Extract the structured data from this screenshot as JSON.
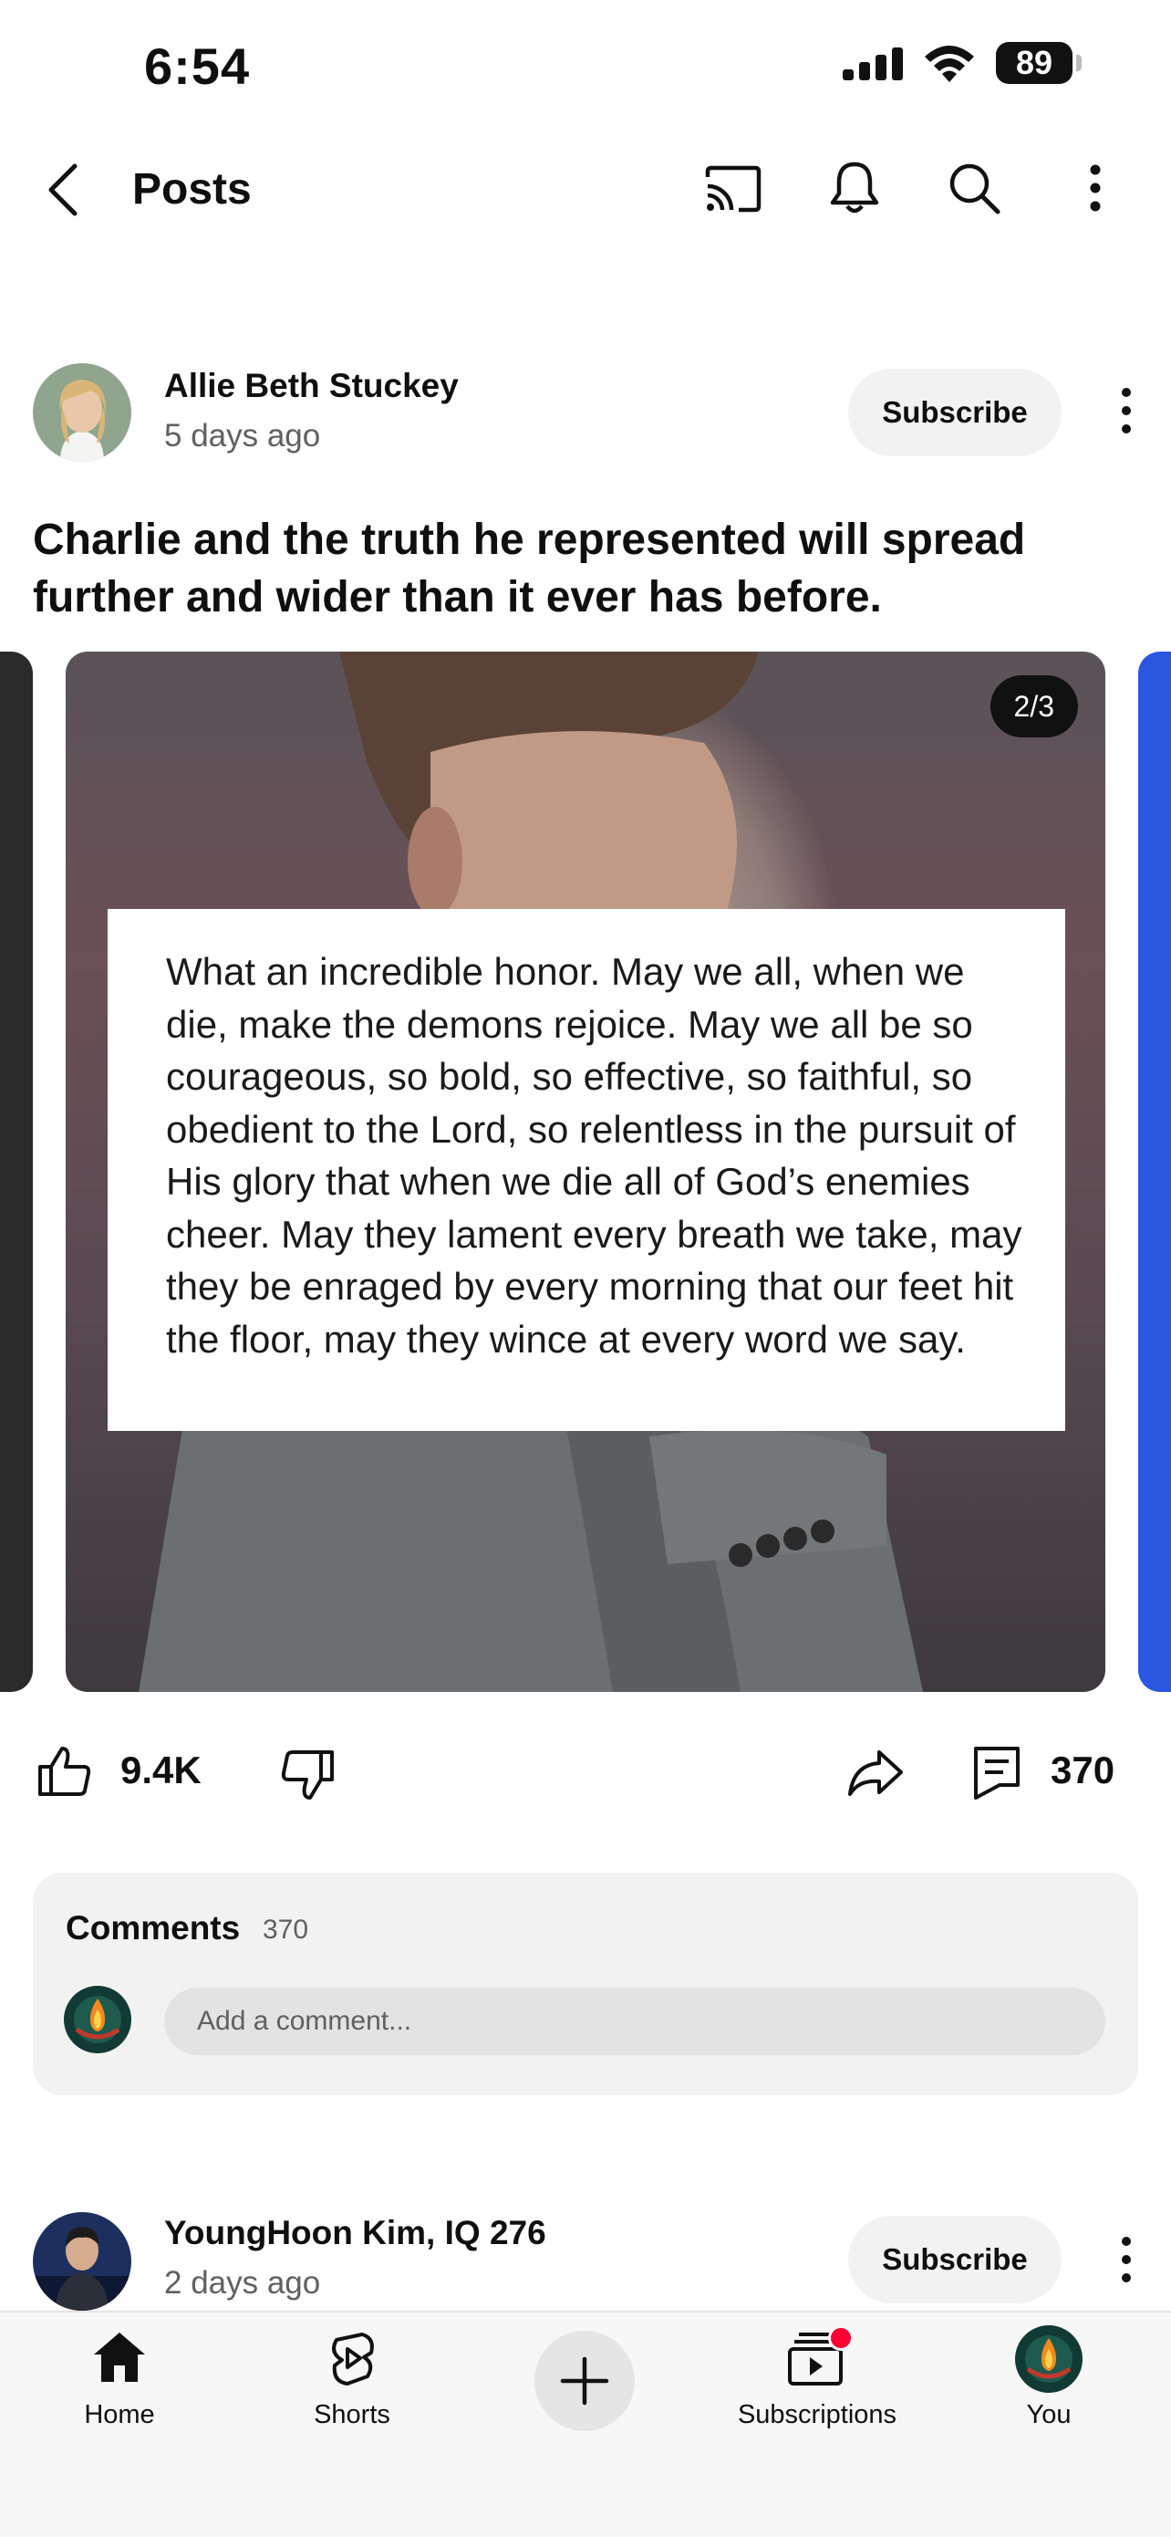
{
  "status_bar": {
    "time": "6:54",
    "battery": "89"
  },
  "app_bar": {
    "title": "Posts"
  },
  "post": {
    "author": "Allie Beth Stuckey",
    "time": "5 days ago",
    "subscribe_label": "Subscribe",
    "text": "Charlie and the truth he represented will spread further and wider than it ever has before.",
    "image_counter": "2/3",
    "image_quote": "What an incredible honor. May we all, when we die, make the demons rejoice. May we all be so courageous, so bold, so effective, so faithful, so obedient to the Lord, so relentless in the pursuit of His glory that when we die all of God’s enemies cheer. May they lament every breath we take, may they be enraged by every morning that our feet hit the floor, may they wince at every word we say.",
    "likes": "9.4K",
    "comments_count": "370"
  },
  "comments": {
    "title": "Comments",
    "count": "370",
    "placeholder": "Add a comment..."
  },
  "next_post": {
    "author": "YoungHoon Kim, IQ 276",
    "time": "2 days ago",
    "subscribe_label": "Subscribe"
  },
  "bottom_nav": {
    "home": "Home",
    "shorts": "Shorts",
    "subscriptions": "Subscriptions",
    "you": "You"
  },
  "colors": {
    "accent_red": "#ff0033",
    "chip_bg": "#f2f2f2",
    "secondary_text": "#606060"
  }
}
